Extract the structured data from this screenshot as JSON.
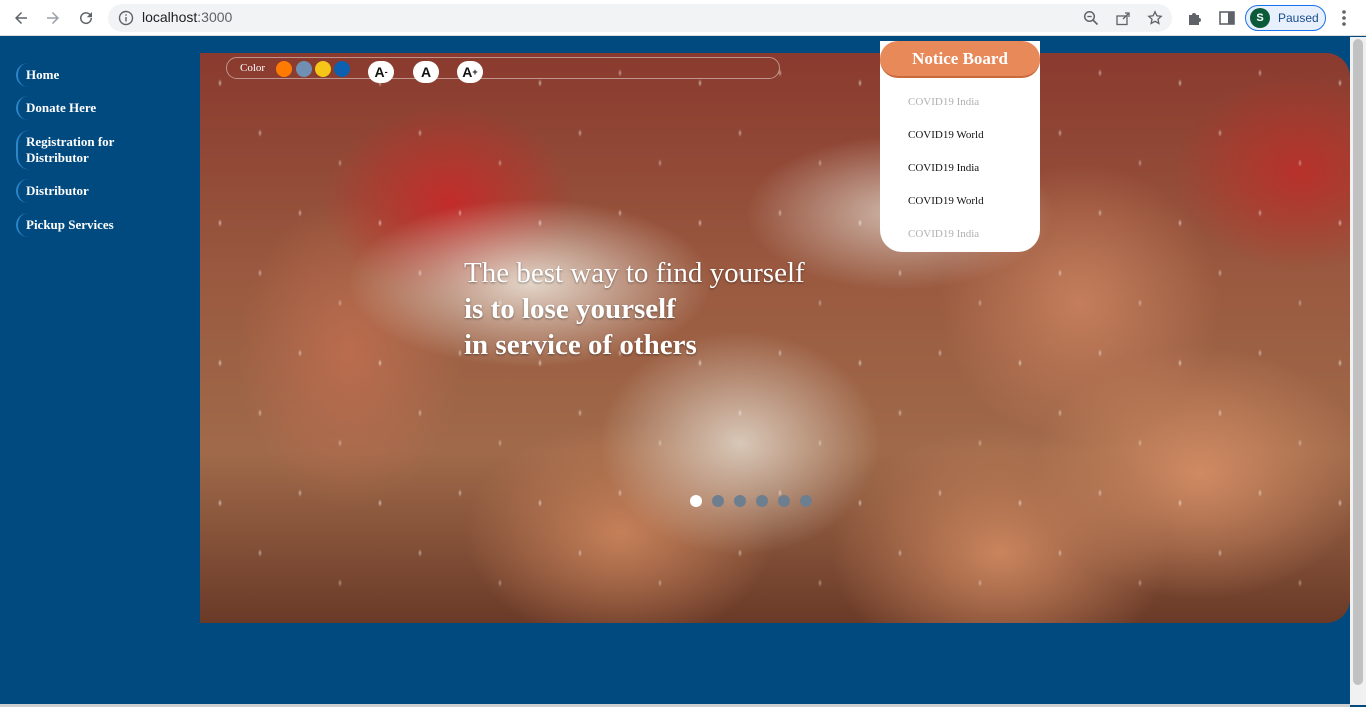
{
  "browser": {
    "url_host": "localhost",
    "url_port": ":3000",
    "profile_initial": "S",
    "profile_status": "Paused"
  },
  "sidebar": {
    "items": [
      {
        "label": "Home"
      },
      {
        "label": "Donate Here"
      },
      {
        "label": "Registration for Distributor"
      },
      {
        "label": "Distributor"
      },
      {
        "label": "Pickup Services"
      }
    ]
  },
  "toolbar": {
    "color_label": "Color",
    "swatches": [
      "#ff7a00",
      "#6f8fb3",
      "#f5c518",
      "#0d5fb0"
    ],
    "font_decrease": "A",
    "font_reset": "A",
    "font_increase": "A",
    "minus": "-",
    "plus": "+"
  },
  "hero": {
    "quote_line1": "The best way to find yourself",
    "quote_line2": "is to lose yourself",
    "quote_line3": "in service of others",
    "slide_count": 6,
    "active_slide": 1
  },
  "notice_board": {
    "title": "Notice Board",
    "items": [
      {
        "label": "COVID19 India"
      },
      {
        "label": "COVID19 World"
      },
      {
        "label": "COVID19 India"
      },
      {
        "label": "COVID19 World"
      },
      {
        "label": "COVID19 India"
      }
    ]
  }
}
